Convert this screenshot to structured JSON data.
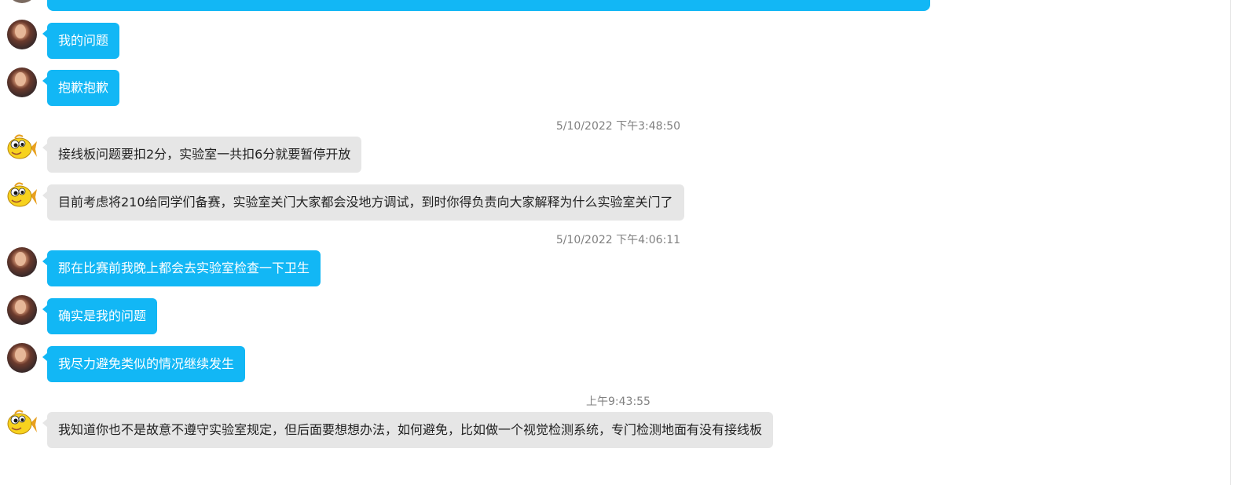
{
  "conversation": {
    "top_partial_message": "",
    "messages": [
      {
        "sender": "self",
        "avatar_icon": "user-avatar-icon",
        "text": "我的问题"
      },
      {
        "sender": "self",
        "avatar_icon": "user-avatar-icon",
        "text": "抱歉抱歉"
      },
      {
        "type": "timestamp",
        "text": "5/10/2022 下午3:48:50"
      },
      {
        "sender": "other",
        "avatar_icon": "fish-avatar-icon",
        "text": "接线板问题要扣2分，实验室一共扣6分就要暂停开放"
      },
      {
        "sender": "other",
        "avatar_icon": "fish-avatar-icon",
        "text": "目前考虑将210给同学们备赛，实验室关门大家都会没地方调试，到时你得负责向大家解释为什么实验室关门了"
      },
      {
        "type": "timestamp",
        "text": "5/10/2022 下午4:06:11"
      },
      {
        "sender": "self",
        "avatar_icon": "user-avatar-icon",
        "text": "那在比赛前我晚上都会去实验室检查一下卫生"
      },
      {
        "sender": "self",
        "avatar_icon": "user-avatar-icon",
        "text": "确实是我的问题"
      },
      {
        "sender": "self",
        "avatar_icon": "user-avatar-icon",
        "text": "我尽力避免类似的情况继续发生"
      },
      {
        "type": "timestamp",
        "text": "上午9:43:55"
      },
      {
        "sender": "other",
        "avatar_icon": "fish-avatar-icon",
        "text": "我知道你也不是故意不遵守实验室规定，但后面要想想办法，如何避免，比如做一个视觉检测系统，专门检测地面有没有接线板"
      }
    ]
  },
  "colors": {
    "self_bubble": "#12b7f5",
    "other_bubble": "#e6e6e6",
    "timestamp_text": "#808080"
  }
}
